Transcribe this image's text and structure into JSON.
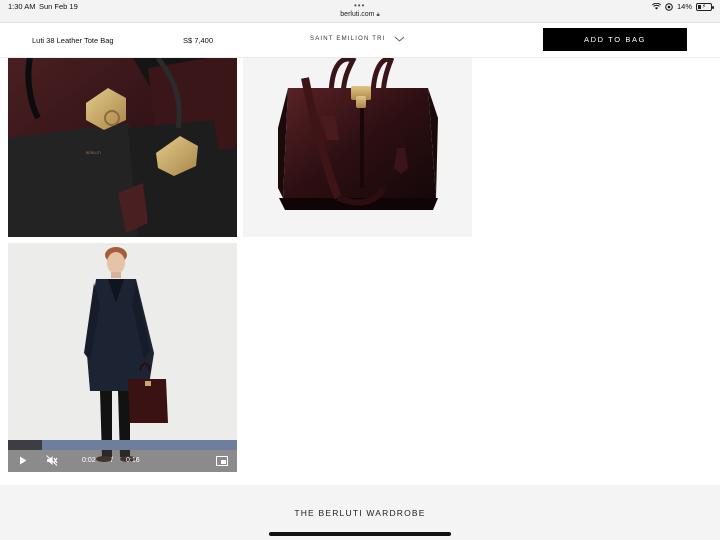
{
  "status_bar": {
    "time": "1:30 AM",
    "date": "Sun Feb 19",
    "url": "berluti.com",
    "battery": "14%",
    "icons": [
      "wifi-icon",
      "location-icon",
      "battery-icon",
      "lock-icon"
    ]
  },
  "product_bar": {
    "name": "Luti 38 Leather Tote Bag",
    "price": "S$ 7,400",
    "color": "SAINT EMILION TRI",
    "add_to_bag": "ADD TO BAG"
  },
  "gallery": {
    "images": [
      {
        "alt": "tote bag interior detail"
      },
      {
        "alt": "tote bag with shoulder strap"
      },
      {
        "alt": "model wearing coat carrying tote bag"
      }
    ],
    "video": {
      "current_time": "0:02",
      "separator": "/",
      "duration": "0:16",
      "progress_fraction": 0.15
    }
  },
  "footer": {
    "title": "THE BERLUTI WARDROBE"
  },
  "colors": {
    "button_bg": "#000000",
    "leather": "#3b1517",
    "brass": "#c9a867",
    "video_progress": "#6e7f9e"
  }
}
